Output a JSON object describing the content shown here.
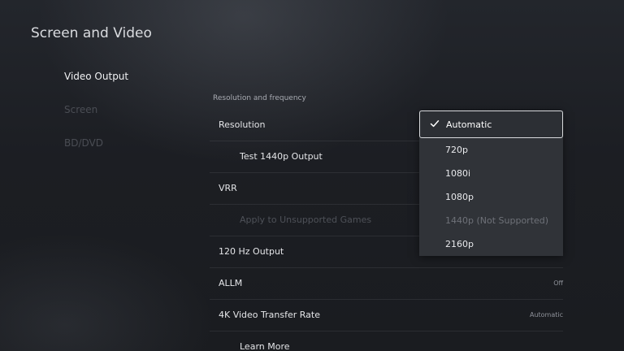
{
  "page": {
    "title": "Screen and Video"
  },
  "sidebar": {
    "items": [
      {
        "label": "Video Output"
      },
      {
        "label": "Screen"
      },
      {
        "label": "BD/DVD"
      }
    ]
  },
  "main": {
    "section_label": "Resolution and frequency",
    "rows": [
      {
        "label": "Resolution"
      },
      {
        "label": "Test 1440p Output"
      },
      {
        "label": "VRR"
      },
      {
        "label": "Apply to Unsupported Games"
      },
      {
        "label": "120 Hz Output"
      },
      {
        "label": "ALLM",
        "value": "Off"
      },
      {
        "label": "4K Video Transfer Rate",
        "value": "Automatic"
      },
      {
        "label": "Learn More"
      }
    ]
  },
  "dropdown": {
    "selected": "Automatic",
    "options": [
      {
        "label": "Automatic",
        "selected": true
      },
      {
        "label": "720p"
      },
      {
        "label": "1080i"
      },
      {
        "label": "1080p"
      },
      {
        "label": "1440p (Not Supported)",
        "supported": false
      },
      {
        "label": "2160p"
      }
    ]
  },
  "icons": {
    "check": "check-icon"
  },
  "colors": {
    "background": "#1a1c21",
    "dropdown": "#303338",
    "selected_border": "#d8dadd"
  }
}
